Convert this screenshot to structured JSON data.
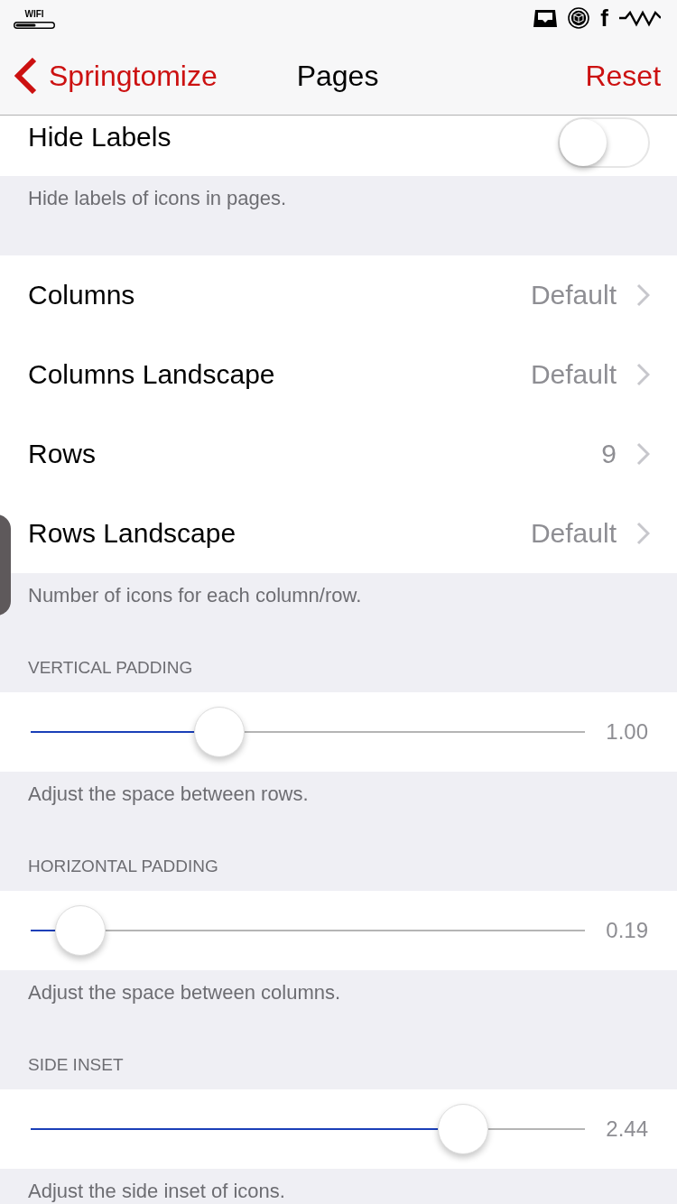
{
  "status_bar": {
    "network_label": "WIFI",
    "glyph": "f"
  },
  "nav_bar": {
    "back": "Springtomize",
    "title": "Pages",
    "action": "Reset"
  },
  "hide_labels": {
    "label": "Hide Labels",
    "on": false,
    "footer": "Hide labels of icons in pages."
  },
  "grid_group": {
    "rows": [
      {
        "label": "Columns",
        "value": "Default"
      },
      {
        "label": "Columns Landscape",
        "value": "Default"
      },
      {
        "label": "Rows",
        "value": "9"
      },
      {
        "label": "Rows Landscape",
        "value": "Default"
      }
    ],
    "footer": "Number of icons for each column/row."
  },
  "sliders": [
    {
      "header": "VERTICAL PADDING",
      "level": 0.34,
      "reading": "1.00",
      "footer": "Adjust the space between rows."
    },
    {
      "header": "HORIZONTAL PADDING",
      "level": 0.09,
      "reading": "0.19",
      "footer": "Adjust the space between columns."
    },
    {
      "header": "SIDE INSET",
      "level": 0.78,
      "reading": "2.44",
      "footer": "Adjust the side inset of icons."
    }
  ]
}
